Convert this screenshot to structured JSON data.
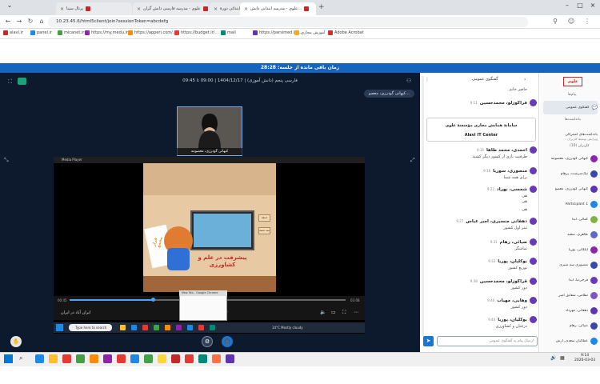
{
  "browser": {
    "tabs": [
      {
        "label": "پرتال سینا"
      },
      {
        "label": "علوی - مدرسه فارسی دانش گران"
      },
      {
        "label": "علوی - فارسی سوم ابتدائی دورهٔ ..."
      },
      {
        "label": "علوی - مدرسه ابتدایی دانش..."
      }
    ],
    "url": "10.23.45.6/html5client/join?sessionToken=abcdefg",
    "bookmarks": [
      "alavi.ir",
      "panel.ir",
      "micanet.ir",
      "https://my.medu.ir/...",
      "https://apperi.com/...",
      "https://budget.ir/...",
      "mail",
      "https://parsimed.ir/...",
      "آموزش مجازی",
      "Adobe Acrobat"
    ]
  },
  "banner": {
    "text": "زمان باقی مانده از جلسه: 28:28"
  },
  "meeting": {
    "title": "فارسی پنجم (دانش آموزی) | 1404/12/17 | 09:00 تا 09:45",
    "user_chip": "کیهانی گودرزی، معصو...",
    "camera_name": "کیهانی گودرزی، معصومه",
    "media_player_title": "Media Player",
    "video_text": "پیشرفت در علم و کشاورزی",
    "flag_text": "قرار مجمع",
    "tv_left_label": "جمعه",
    "tv_right_label": "سه شنبه",
    "player_label": "ایران آباد در ایران",
    "time_current": "00:45",
    "time_total": "03:08",
    "inner_search": "Type here to search",
    "inner_weather": "14°C  Mostly cloudy",
    "popup_title": "New Tab - Google Chrome"
  },
  "chat": {
    "header": "گفتگوی عمومی",
    "notice_line1": "سامانهٔ همایش مجازی مؤسسهٔ علوی",
    "notice_line2": "Alavi IT Center",
    "messages": [
      {
        "name": "",
        "body": "حاضر خانم",
        "time": ""
      },
      {
        "name": "قراگوزلو، محمدحسین",
        "body": "",
        "time": "9:11"
      },
      {
        "name": "احمدی، محمد طاها",
        "body": "ظرفیت بازی از کشور دیگر کشید",
        "time": "9:14"
      },
      {
        "name": "منصوری، سوریا",
        "body": "برای همه شما",
        "time": "9:16"
      },
      {
        "name": "شمسی، بهزاد",
        "body": "هی",
        "time": "9:22"
      },
      {
        "name": "",
        "body": "هی",
        "time": ""
      },
      {
        "name": "",
        "body": "هی",
        "time": ""
      },
      {
        "name": "دهقانی منسیری، امیر عباس",
        "body": "تیتر اول کشور",
        "time": "9:27"
      },
      {
        "name": "ضیائی، رهام",
        "body": "تماشگر",
        "time": "9:31"
      },
      {
        "name": "بوکلیان، پوریا",
        "body": "توزیع کشور",
        "time": "9:33"
      },
      {
        "name": "قراگوزلو، محمدحسین",
        "body": "دور کشور",
        "time": "9:38"
      },
      {
        "name": "وهابی، مهیاب",
        "body": "دور کشور",
        "time": "9:40"
      },
      {
        "name": "بوکلیان، پوریا",
        "body": "درختان و کشاورزی",
        "time": "9:44"
      }
    ],
    "input_placeholder": "ارسال پیام به گفتگوی عمومی"
  },
  "participants": {
    "logo": "علوی",
    "section_messages": "پیام‌ها",
    "public_chat": "گفتگوی عمومی",
    "section_notes": "یادداشت‌ها",
    "shared_notes": "یادداشت‌های اشتراکی",
    "shared_notes_sub": "ویرایش توسط کاربران",
    "section_users": "کاربران (10)",
    "users": [
      {
        "name": "کیهانی گودرزی، معصومه",
        "color": "#8e24aa"
      },
      {
        "name": "نیک‌سرشت، پرهام",
        "color": "#3949ab"
      },
      {
        "name": "کیهانی گودرزی، معصو",
        "color": "#5e35b1"
      },
      {
        "name": "Participant 1",
        "color": "#1e88e5"
      },
      {
        "name": "کمالی، آیدا",
        "color": "#7cb342"
      },
      {
        "name": "طاهری، سعید",
        "color": "#5c6bc0"
      },
      {
        "name": "ایلکانی، پوریا",
        "color": "#8e24aa"
      },
      {
        "name": "منصوری سه منیری",
        "color": "#3949ab"
      },
      {
        "name": "فرجی‌نیا، آیدا",
        "color": "#673ab7"
      },
      {
        "name": "نظامی، شقایق امیر",
        "color": "#7e57c2"
      },
      {
        "name": "دهقانی، مهرداد",
        "color": "#5e35b1"
      },
      {
        "name": "ضیائی، رهام",
        "color": "#3949ab"
      },
      {
        "name": "عطائیان سعدی، آرش",
        "color": "#1e88e5"
      }
    ]
  },
  "taskbar": {
    "search_label": "",
    "clock_time": "9:14",
    "clock_date": "2026-03-03",
    "icon_colors": [
      "#1e88e5",
      "#fbc02d",
      "#e53935",
      "#43a047",
      "#fb8c00",
      "#8e24aa",
      "#e53935",
      "#1e88e5",
      "#43a047",
      "#fdd835",
      "#c62828",
      "#e53935",
      "#00897b",
      "#ff7043",
      "#5e35b1"
    ]
  }
}
